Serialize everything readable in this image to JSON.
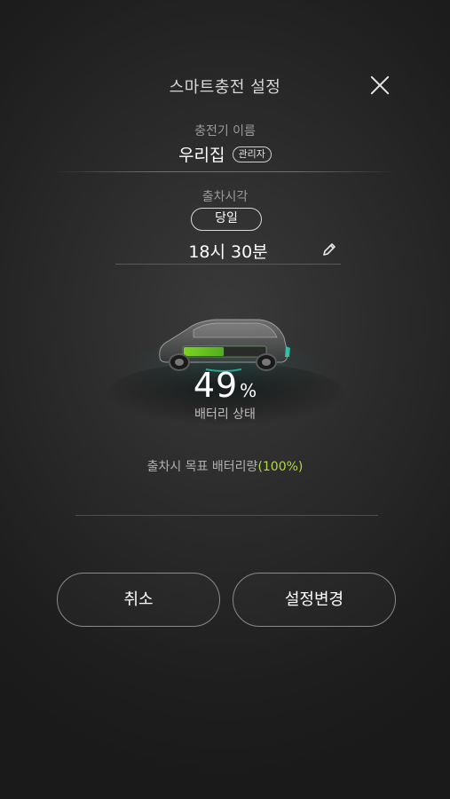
{
  "header": {
    "title": "스마트충전 설정",
    "close_icon": "close-icon"
  },
  "charger": {
    "label": "충전기 이름",
    "name": "우리집",
    "role_badge": "관리자"
  },
  "departure": {
    "label": "출차시각",
    "day": "당일",
    "time": "18시 30분",
    "edit_icon": "pencil-icon"
  },
  "battery": {
    "value": "49",
    "unit": "%",
    "label": "배터리 상태",
    "level_fraction": 0.49
  },
  "target": {
    "text": "출차시 목표 배터리량",
    "value": "(100%)"
  },
  "actions": {
    "cancel_label": "취소",
    "confirm_label": "설정변경"
  },
  "colors": {
    "accent_green": "#b4d640",
    "battery_green": "#7ed321",
    "glow_teal": "#2ed3b7",
    "background": "#2a2a2a"
  }
}
